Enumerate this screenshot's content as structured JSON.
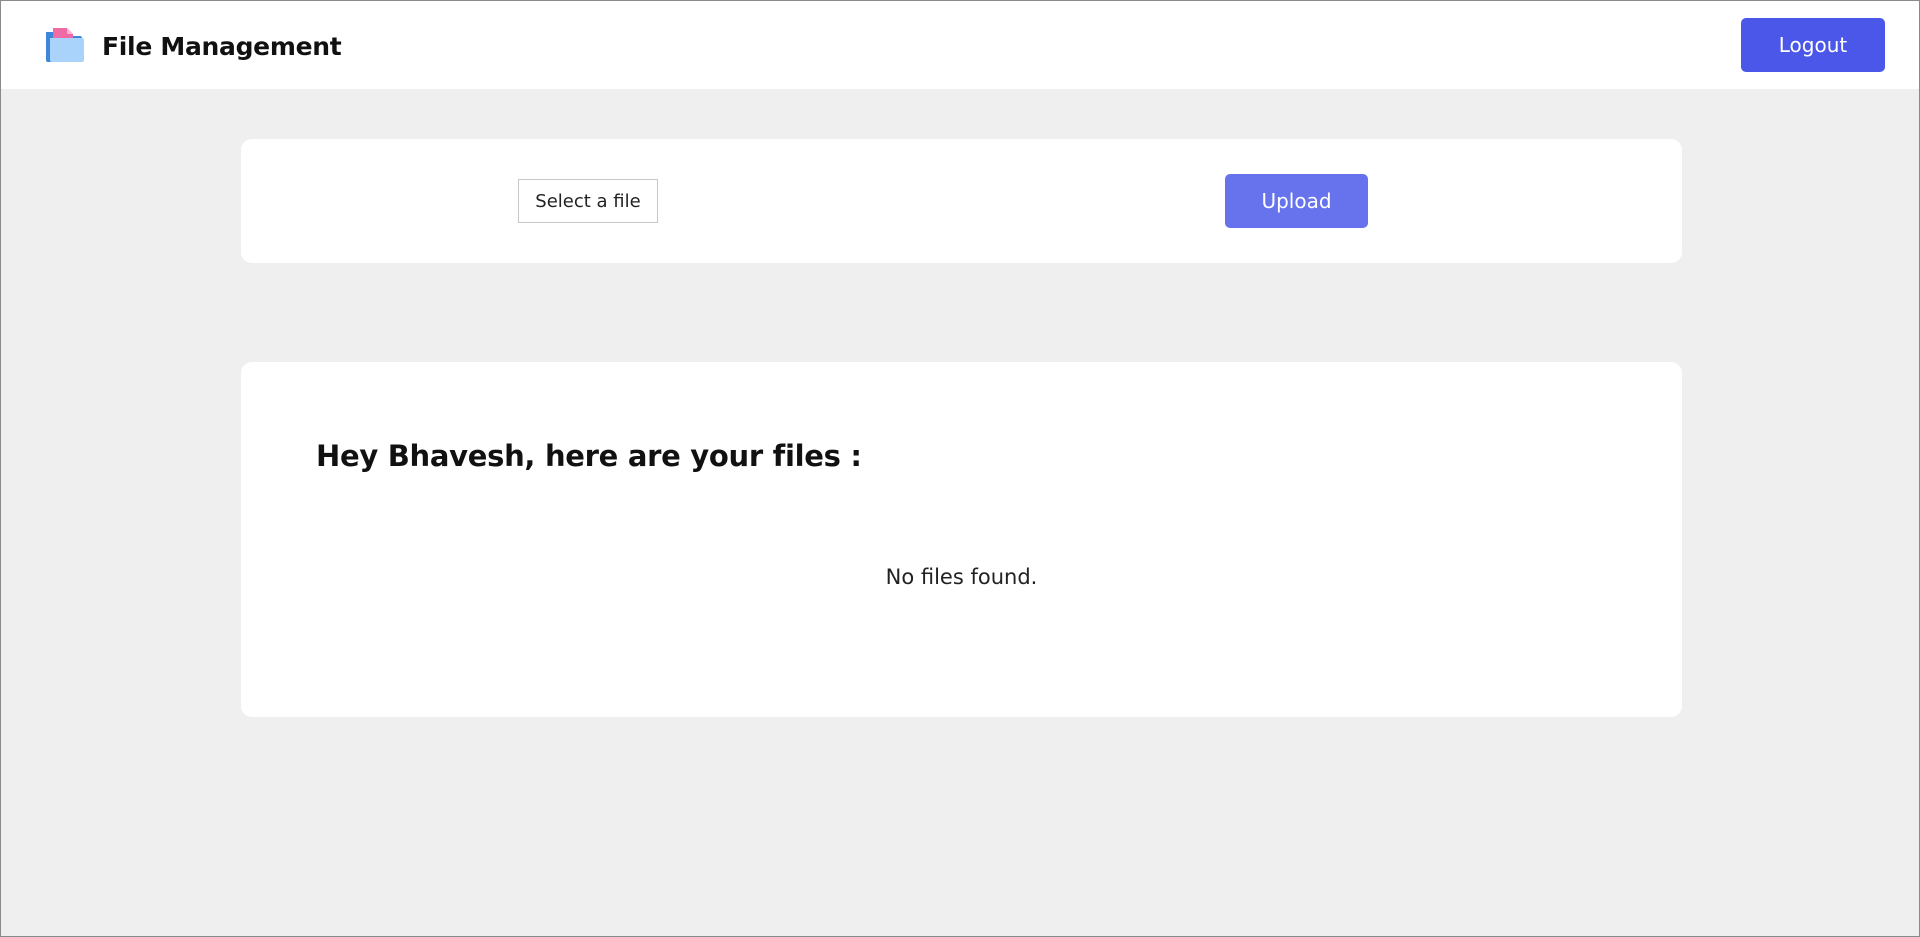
{
  "header": {
    "logo_icon": "folder-icon",
    "title": "File Management",
    "logout_label": "Logout"
  },
  "upload": {
    "select_label": "Select a file",
    "upload_label": "Upload"
  },
  "files": {
    "heading": "Hey Bhavesh, here are your files :",
    "empty_message": "No files found."
  },
  "colors": {
    "background": "#efefef",
    "logout_button": "#4b57e8",
    "upload_button": "#6673ed"
  }
}
